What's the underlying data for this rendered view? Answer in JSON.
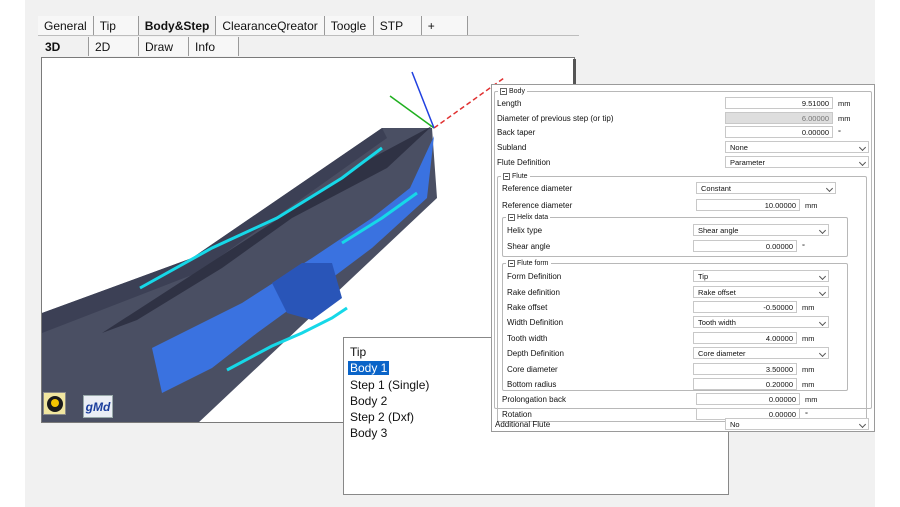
{
  "top_tabs": [
    "General",
    "Tip",
    "Body&Step",
    "ClearanceQreator",
    "Toogle",
    "STP",
    "+"
  ],
  "sub_tabs": [
    "3D",
    "2D",
    "Draw",
    "Info"
  ],
  "logos": {
    "brand": "gMd"
  },
  "body_list": [
    "Tip",
    "Body 1",
    "Step 1 (Single)",
    "Body 2",
    "Step 2 (Dxf)",
    "Body 3"
  ],
  "body_list_selected": "Body 1",
  "props": {
    "body": {
      "title": "Body",
      "length": {
        "label": "Length",
        "value": "9.51000",
        "unit": "mm"
      },
      "prev_diameter": {
        "label": "Diameter of previous step (or tip)",
        "value": "6.00000",
        "unit": "mm"
      },
      "back_taper": {
        "label": "Back taper",
        "value": "0.00000",
        "unit": "°"
      },
      "subland": {
        "label": "Subland",
        "value": "None"
      },
      "flute_definition": {
        "label": "Flute Definition",
        "value": "Parameter"
      }
    },
    "flute": {
      "title": "Flute",
      "ref_diameter_mode": {
        "label": "Reference diameter",
        "value": "Constant"
      },
      "ref_diameter": {
        "label": "Reference diameter",
        "value": "10.00000",
        "unit": "mm"
      },
      "helix": {
        "title": "Helix data",
        "helix_type": {
          "label": "Helix type",
          "value": "Shear angle"
        },
        "shear_angle": {
          "label": "Shear angle",
          "value": "0.00000",
          "unit": "°"
        }
      },
      "form": {
        "title": "Flute form",
        "form_definition": {
          "label": "Form Definition",
          "value": "Tip"
        },
        "rake_definition": {
          "label": "Rake definition",
          "value": "Rake offset"
        },
        "rake_offset": {
          "label": "Rake offset",
          "value": "-0.50000",
          "unit": "mm"
        },
        "width_definition": {
          "label": "Width Definition",
          "value": "Tooth width"
        },
        "tooth_width": {
          "label": "Tooth width",
          "value": "4.00000",
          "unit": "mm"
        },
        "depth_definition": {
          "label": "Depth Definition",
          "value": "Core diameter"
        },
        "core_diameter": {
          "label": "Core diameter",
          "value": "3.50000",
          "unit": "mm"
        },
        "bottom_radius": {
          "label": "Bottom radius",
          "value": "0.20000",
          "unit": "mm"
        }
      },
      "prolongation_back": {
        "label": "Prolongation back",
        "value": "0.00000",
        "unit": "mm"
      },
      "rotation": {
        "label": "Rotation",
        "value": "0.00000",
        "unit": "°"
      }
    },
    "additional_flute": {
      "label": "Additional Flute",
      "value": "No"
    }
  },
  "colors": {
    "tool_gray": "#4a4f63",
    "tool_dark": "#2f3244",
    "flute_blue": "#3a72e0",
    "edge_cyan": "#16d8e8",
    "axis_red": "#e03030",
    "axis_green": "#20b020",
    "axis_blue": "#2040e0",
    "selection": "#0a64c8"
  }
}
